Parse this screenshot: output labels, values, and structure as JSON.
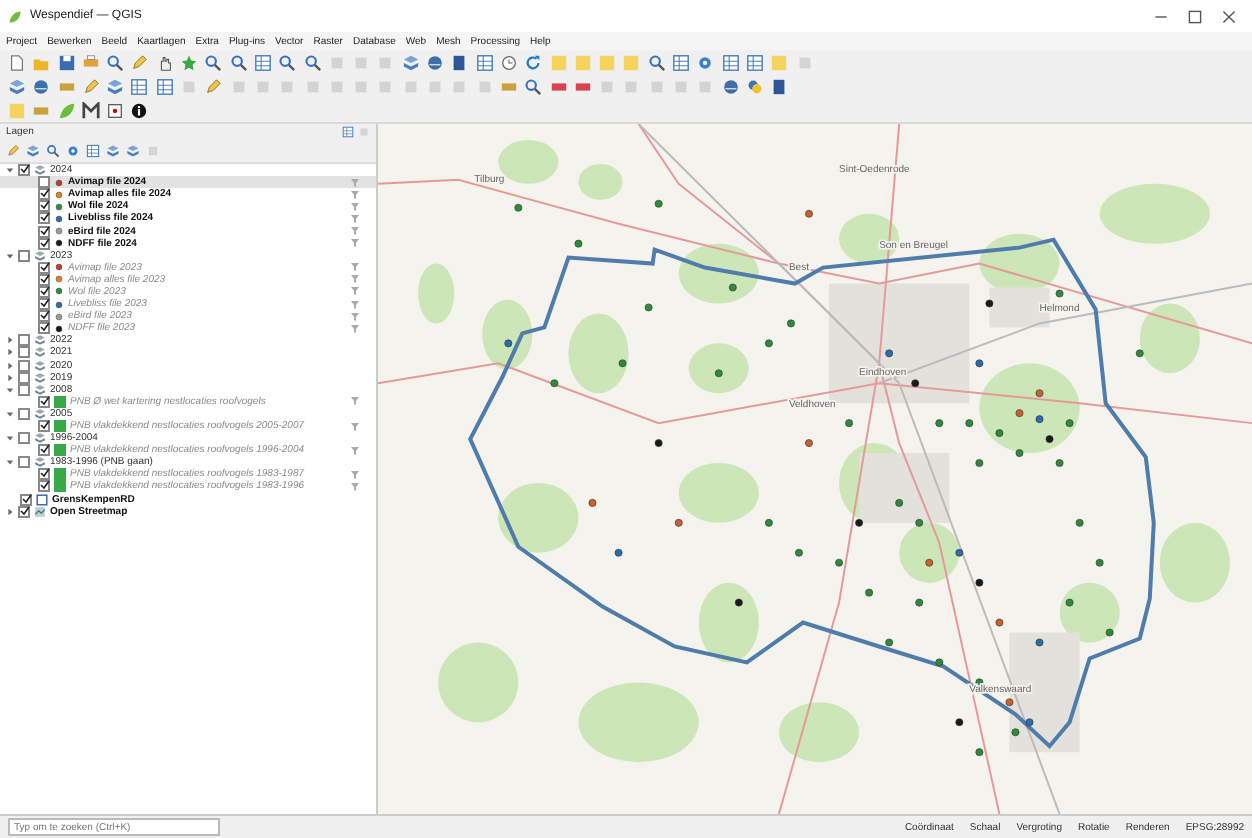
{
  "window": {
    "title": "Wespendief — QGIS"
  },
  "menu": [
    "Project",
    "Bewerken",
    "Beeld",
    "Kaartlagen",
    "Extra",
    "Plug-ins",
    "Vector",
    "Raster",
    "Database",
    "Web",
    "Mesh",
    "Processing",
    "Help"
  ],
  "layers_panel": {
    "title": "Lagen",
    "layers": [
      {
        "kind": "group",
        "name": "2024",
        "checked": true,
        "expanded": true,
        "children": [
          {
            "kind": "point",
            "name": "Avimap file 2024",
            "checked": false,
            "selected": true,
            "color": "#c0392b",
            "filtered": true
          },
          {
            "kind": "point",
            "name": "Avimap alles file 2024",
            "checked": true,
            "selected": false,
            "color": "#e67e22",
            "filtered": true
          },
          {
            "kind": "point",
            "name": "Wol file 2024",
            "checked": true,
            "selected": false,
            "color": "#2e8b3a",
            "filtered": true
          },
          {
            "kind": "point",
            "name": "Livebliss file 2024",
            "checked": true,
            "selected": false,
            "color": "#2b6cb0",
            "filtered": true
          },
          {
            "kind": "point",
            "name": "eBird file 2024",
            "checked": true,
            "selected": false,
            "color": "#9a9a9a",
            "filtered": true
          },
          {
            "kind": "point",
            "name": "NDFF file 2024",
            "checked": true,
            "selected": false,
            "color": "#1a1a1a",
            "filtered": true
          }
        ]
      },
      {
        "kind": "group",
        "name": "2023",
        "checked": false,
        "expanded": true,
        "children": [
          {
            "kind": "point",
            "name": "Avimap file 2023",
            "checked": true,
            "selected": false,
            "color": "#c0392b",
            "filtered": true
          },
          {
            "kind": "point",
            "name": "Avimap alles file 2023",
            "checked": true,
            "selected": false,
            "color": "#e67e22",
            "filtered": true
          },
          {
            "kind": "point",
            "name": "Wol file 2023",
            "checked": true,
            "selected": false,
            "color": "#2e8b3a",
            "filtered": true
          },
          {
            "kind": "point",
            "name": "Livebliss file 2023",
            "checked": true,
            "selected": false,
            "color": "#2b6cb0",
            "filtered": true
          },
          {
            "kind": "point",
            "name": "eBird file 2023",
            "checked": true,
            "selected": false,
            "color": "#9a9a9a",
            "filtered": true
          },
          {
            "kind": "point",
            "name": "NDFF file 2023",
            "checked": true,
            "selected": false,
            "color": "#1a1a1a",
            "filtered": true
          }
        ]
      },
      {
        "kind": "group",
        "name": "2022",
        "checked": false,
        "expanded": false
      },
      {
        "kind": "group",
        "name": "2021",
        "checked": false,
        "expanded": false
      },
      {
        "kind": "group",
        "name": "2020",
        "checked": false,
        "expanded": false
      },
      {
        "kind": "group",
        "name": "2019",
        "checked": false,
        "expanded": false
      },
      {
        "kind": "group",
        "name": "2008",
        "checked": false,
        "expanded": true,
        "children": [
          {
            "kind": "polygon",
            "name": "PNB Ø wet kartering nestlocaties roofvogels",
            "checked": true,
            "selected": false,
            "color": "#3aa845",
            "filtered": true
          }
        ]
      },
      {
        "kind": "group",
        "name": "2005",
        "checked": false,
        "expanded": true,
        "children": [
          {
            "kind": "polygon",
            "name": "PNB vlakdekkend nestlocaties roofvogels 2005-2007",
            "checked": true,
            "selected": false,
            "color": "#3aa845",
            "filtered": true
          }
        ]
      },
      {
        "kind": "group",
        "name": "1996-2004",
        "checked": false,
        "expanded": true,
        "children": [
          {
            "kind": "polygon",
            "name": "PNB vlakdekkend nestlocaties roofvogels 1996-2004",
            "checked": true,
            "selected": false,
            "color": "#3aa845",
            "filtered": true
          }
        ]
      },
      {
        "kind": "group",
        "name": "1983-1996 (PNB gaan)",
        "checked": false,
        "expanded": true,
        "children": [
          {
            "kind": "polygon",
            "name": "PNB vlakdekkend nestlocaties roofvogels 1983-1987",
            "checked": true,
            "selected": false,
            "color": "#3aa845",
            "filtered": true
          },
          {
            "kind": "polygon",
            "name": "PNB vlakdekkend nestlocaties roofvogels 1983-1996",
            "checked": true,
            "selected": false,
            "color": "#3aa845",
            "filtered": true
          }
        ]
      },
      {
        "kind": "outline",
        "name": "GrensKempenRD",
        "checked": true,
        "selected": false,
        "filtered": false
      },
      {
        "kind": "raster",
        "name": "Open Streetmap",
        "checked": true,
        "selected": false,
        "filtered": false,
        "expanded": false
      }
    ]
  },
  "map": {
    "place_labels": [
      "Tilburg",
      "Sint-Oedenrode",
      "Son en Breugel",
      "Best",
      "Eindhoven",
      "Veldhoven",
      "Helmond",
      "Valkenswaard"
    ]
  },
  "status_bar": {
    "search_placeholder": "Typ om te zoeken (Ctrl+K)",
    "labels": [
      "Coördinaat",
      "Schaal",
      "Vergroting",
      "Rotatie",
      "Renderen",
      "EPSG:28992"
    ]
  }
}
